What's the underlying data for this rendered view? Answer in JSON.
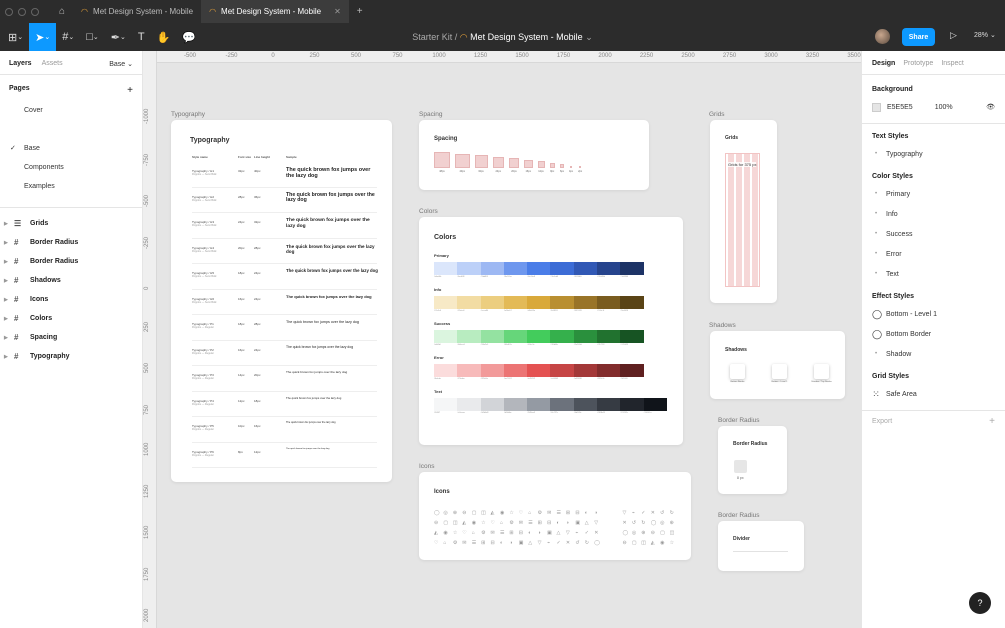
{
  "tabs": [
    {
      "label": "Met Design System - Mobile",
      "active": false
    },
    {
      "label": "Met Design System - Mobile",
      "active": true
    }
  ],
  "toolbar": {
    "project": "Starter Kit",
    "separator": "/",
    "file": "Met Design System - Mobile",
    "share": "Share",
    "zoom": "28%"
  },
  "left": {
    "tab_layers": "Layers",
    "tab_assets": "Assets",
    "page_select": "Base",
    "pages_title": "Pages",
    "pages": [
      "Cover",
      "Base",
      "Components",
      "Examples"
    ],
    "layers": [
      {
        "icon": "layout-icon",
        "label": "Grids"
      },
      {
        "icon": "frame-icon",
        "label": "Border Radius"
      },
      {
        "icon": "frame-icon",
        "label": "Border Radius"
      },
      {
        "icon": "frame-icon",
        "label": "Shadows"
      },
      {
        "icon": "frame-icon",
        "label": "Icons"
      },
      {
        "icon": "frame-icon",
        "label": "Colors"
      },
      {
        "icon": "frame-icon",
        "label": "Spacing"
      },
      {
        "icon": "frame-icon",
        "label": "Typography"
      }
    ]
  },
  "ruler_top": [
    "-500",
    "-250",
    "0",
    "250",
    "500",
    "750",
    "1000",
    "1250",
    "1500",
    "1750",
    "2000",
    "2250",
    "2500",
    "2750",
    "3000",
    "3250",
    "3500"
  ],
  "ruler_left": [
    "-1000",
    "-750",
    "-500",
    "-250",
    "0",
    "250",
    "500",
    "750",
    "1000",
    "1250",
    "1500",
    "1750",
    "2000"
  ],
  "canvas": {
    "labels": {
      "typography": "Typography",
      "spacing": "Spacing",
      "colors": "Colors",
      "icons": "Icons",
      "grids": "Grids",
      "shadows": "Shadows",
      "border_radius_1": "Border Radius",
      "border_radius_2": "Border Radius"
    },
    "typography": {
      "title": "Typography",
      "headers": [
        "Style name",
        "Font size",
        "Line height",
        "Sample"
      ],
      "rows": [
        {
          "name": "Typography / H1",
          "sub": "Poppins — Semi Bold",
          "size": "32px",
          "lh": "40px",
          "sample": "The quick brown fox jumps over the lazy dog"
        },
        {
          "name": "Typography / H2",
          "sub": "Poppins — Semi Bold",
          "size": "28px",
          "lh": "36px",
          "sample": "The quick brown fox jumps over the lazy dog"
        },
        {
          "name": "Typography / H3",
          "sub": "Poppins — Semi Bold",
          "size": "24px",
          "lh": "32px",
          "sample": "The quick brown fox jumps over the lazy dog"
        },
        {
          "name": "Typography / H4",
          "sub": "Poppins — Semi Bold",
          "size": "20px",
          "lh": "28px",
          "sample": "The quick brown fox jumps over the lazy dog"
        },
        {
          "name": "Typography / H5",
          "sub": "Poppins — Semi Bold",
          "size": "18px",
          "lh": "24px",
          "sample": "The quick brown fox jumps over the lazy dog"
        },
        {
          "name": "Typography / H6",
          "sub": "Poppins — Semi Bold",
          "size": "16px",
          "lh": "24px",
          "sample": "The quick brown fox jumps over the lazy dog"
        },
        {
          "name": "Typography / P1",
          "sub": "Poppins — Regular",
          "size": "18px",
          "lh": "28px",
          "sample": "The quick brown fox jumps over the lazy dog"
        },
        {
          "name": "Typography / P2",
          "sub": "Poppins — Regular",
          "size": "16px",
          "lh": "24px",
          "sample": "The quick brown fox jumps over the lazy dog"
        },
        {
          "name": "Typography / P3",
          "sub": "Poppins — Regular",
          "size": "14px",
          "lh": "20px",
          "sample": "The quick brown fox jumps over the lazy dog"
        },
        {
          "name": "Typography / P4",
          "sub": "Poppins — Regular",
          "size": "12px",
          "lh": "18px",
          "sample": "The quick brown fox jumps over the lazy dog"
        },
        {
          "name": "Typography / P5",
          "sub": "Poppins — Regular",
          "size": "10px",
          "lh": "16px",
          "sample": "The quick brown fox jumps over the lazy dog"
        },
        {
          "name": "Typography / P6",
          "sub": "Poppins — Regular",
          "size": "8px",
          "lh": "12px",
          "sample": "The quick brown fox jumps over the lazy dog"
        }
      ]
    },
    "spacing": {
      "title": "Spacing",
      "swatches": [
        "48px",
        "40px",
        "32px",
        "24px",
        "20px",
        "16px",
        "12px",
        "8px",
        "6px",
        "4px",
        "2px"
      ]
    },
    "colors": {
      "title": "Colors",
      "groups": [
        {
          "name": "Primary",
          "hex": [
            "#dbe6fb",
            "#bcd0f8",
            "#9db8f3",
            "#6e97ee",
            "#4a7de8",
            "#3c6cd6",
            "#3158b5",
            "#26448d",
            "#1d3366"
          ]
        },
        {
          "name": "Info",
          "hex": [
            "#f7e9c6",
            "#f2dca3",
            "#ecce80",
            "#e3ba57",
            "#d9a93a",
            "#b98f31",
            "#997428",
            "#7a5c1f",
            "#5a4416"
          ]
        },
        {
          "name": "Success",
          "hex": [
            "#dbf5df",
            "#b8ecc0",
            "#94e2a1",
            "#66d67a",
            "#43cc5c",
            "#35b04c",
            "#2a903d",
            "#21722f",
            "#175423"
          ]
        },
        {
          "name": "Error",
          "hex": [
            "#fbdcdc",
            "#f7baba",
            "#f29a9a",
            "#ec7474",
            "#e45252",
            "#c64545",
            "#a33838",
            "#822c2c",
            "#5f2020"
          ]
        },
        {
          "name": "Text",
          "hex": [
            "#f5f6f7",
            "#e9eaec",
            "#d2d4d8",
            "#b3b6bc",
            "#949aa3",
            "#6c727c",
            "#4d535c",
            "#363b43",
            "#21252c",
            "#10141a"
          ]
        }
      ]
    },
    "icons": {
      "title": "Icons"
    },
    "grids": {
      "title": "Grids",
      "label": "Grids for 375 px"
    },
    "shadows": {
      "title": "Shadows",
      "items": [
        "Bottom Border",
        "Bottom - Level 1",
        "Shadow / Top Border"
      ]
    },
    "border_radius": {
      "title": "Border Radius",
      "item": "8 px"
    },
    "divider": {
      "title": "Divider"
    }
  },
  "right": {
    "tab_design": "Design",
    "tab_prototype": "Prototype",
    "tab_inspect": "Inspect",
    "background_title": "Background",
    "bg_hex": "E5E5E5",
    "bg_opacity": "100%",
    "text_styles_title": "Text Styles",
    "text_styles": [
      "Typography"
    ],
    "color_styles_title": "Color Styles",
    "color_styles": [
      "Primary",
      "Info",
      "Success",
      "Error",
      "Text"
    ],
    "effect_styles_title": "Effect Styles",
    "effect_styles": [
      {
        "icon": "effect-icon",
        "label": "Bottom - Level 1"
      },
      {
        "icon": "effect-icon",
        "label": "Bottom Border"
      },
      {
        "icon": "dot-icon",
        "label": "Shadow"
      }
    ],
    "grid_styles_title": "Grid Styles",
    "grid_styles": [
      "Safe Area"
    ],
    "export_title": "Export"
  },
  "help": "?"
}
